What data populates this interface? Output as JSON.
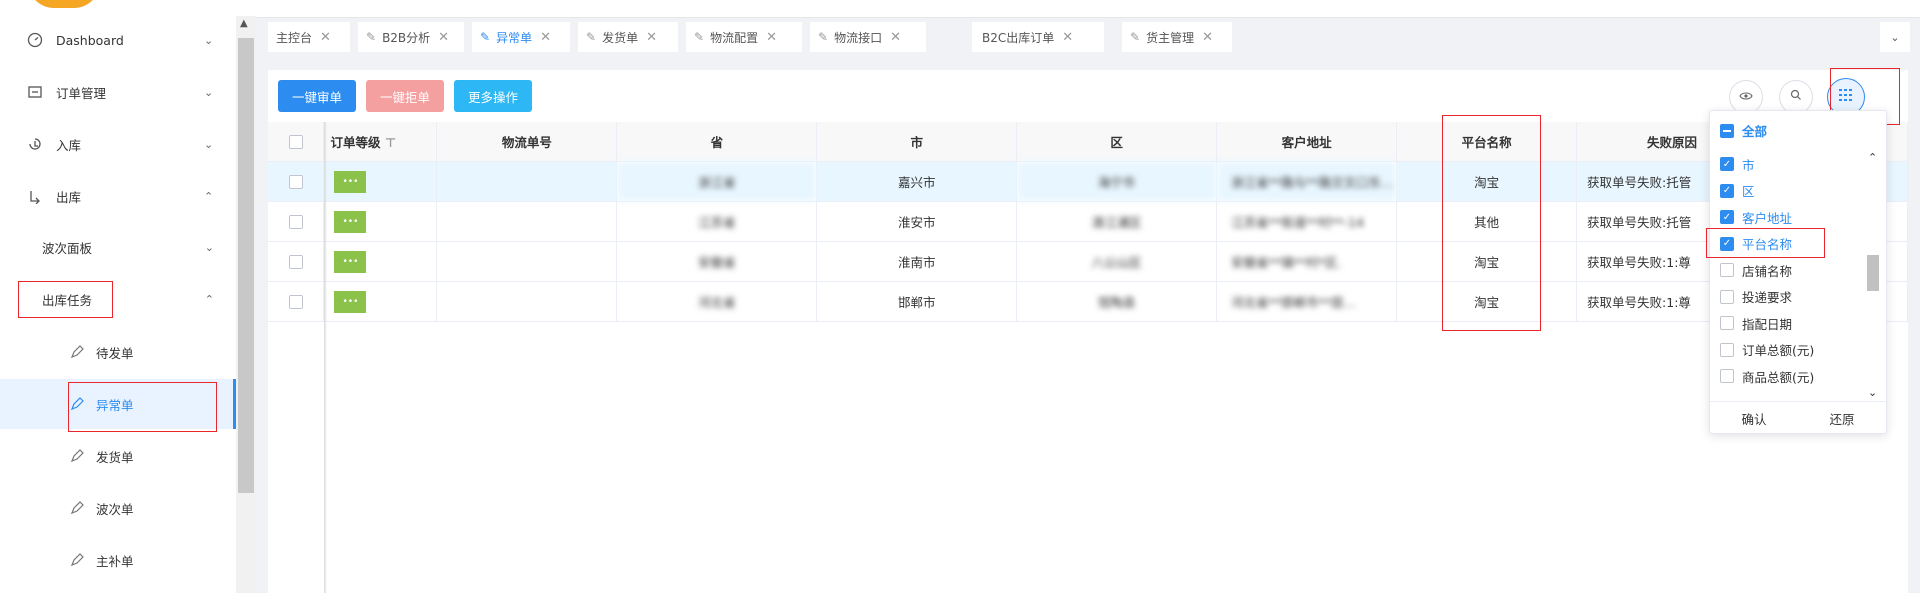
{
  "sidebar": {
    "items": [
      {
        "label": "Dashboard",
        "icon": "dashboard-icon"
      },
      {
        "label": "订单管理",
        "icon": "order-icon"
      },
      {
        "label": "入库",
        "icon": "inbound-icon"
      },
      {
        "label": "出库",
        "icon": "outbound-icon"
      }
    ],
    "sub_items": [
      {
        "label": "波次面板"
      },
      {
        "label": "出库任务"
      }
    ],
    "leaves": [
      {
        "label": "待发单"
      },
      {
        "label": "异常单"
      },
      {
        "label": "发货单"
      },
      {
        "label": "波次单"
      },
      {
        "label": "主补单"
      }
    ]
  },
  "tabs": [
    {
      "label": "主控台"
    },
    {
      "label": "B2B分析"
    },
    {
      "label": "异常单"
    },
    {
      "label": "发货单"
    },
    {
      "label": "物流配置"
    },
    {
      "label": "物流接口"
    },
    {
      "label": "B2C出库订单"
    },
    {
      "label": "货主管理"
    }
  ],
  "toolbar": {
    "approve_label": "一键审单",
    "reject_label": "一键拒单",
    "more_label": "更多操作",
    "approve_color": "#2d8cf0",
    "reject_color": "#f4a0a0",
    "more_color": "#2db7f5"
  },
  "table": {
    "headers": [
      "订单等级",
      "物流单号",
      "省",
      "市",
      "区",
      "客户地址",
      "平台名称",
      "失败原因"
    ],
    "rows": [
      {
        "grade": "•••",
        "tracking": "",
        "province": "浙江省",
        "city": "嘉兴市",
        "district": "海宁市",
        "address": "浙江省**路与**路交叉口东…",
        "platform": "淘宝",
        "reason": "获取单号失败:托管"
      },
      {
        "grade": "•••",
        "tracking": "",
        "province": "江苏省",
        "city": "淮安市",
        "district": "清江浦区",
        "address": "江苏省**街道**村**-14",
        "platform": "其他",
        "reason": "获取单号失败:托管"
      },
      {
        "grade": "•••",
        "tracking": "",
        "province": "安徽省",
        "city": "淮南市",
        "district": "八公山区",
        "address": "安徽省**镇**村*区.",
        "platform": "淘宝",
        "reason": "获取单号失败:1:尊"
      },
      {
        "grade": "•••",
        "tracking": "",
        "province": "河北省",
        "city": "邯郸市",
        "district": "馆陶县",
        "address": "河北省**邯郸市**层…",
        "platform": "淘宝",
        "reason": "获取单号失败:1:尊"
      }
    ]
  },
  "column_picker": {
    "all_label": "全部",
    "items": [
      {
        "label": "市",
        "checked": true
      },
      {
        "label": "区",
        "checked": true
      },
      {
        "label": "客户地址",
        "checked": true
      },
      {
        "label": "平台名称",
        "checked": true
      },
      {
        "label": "店铺名称",
        "checked": false
      },
      {
        "label": "投递要求",
        "checked": false
      },
      {
        "label": "指配日期",
        "checked": false
      },
      {
        "label": "订单总额(元)",
        "checked": false
      },
      {
        "label": "商品总额(元)",
        "checked": false
      }
    ],
    "confirm_label": "确认",
    "reset_label": "还原"
  }
}
